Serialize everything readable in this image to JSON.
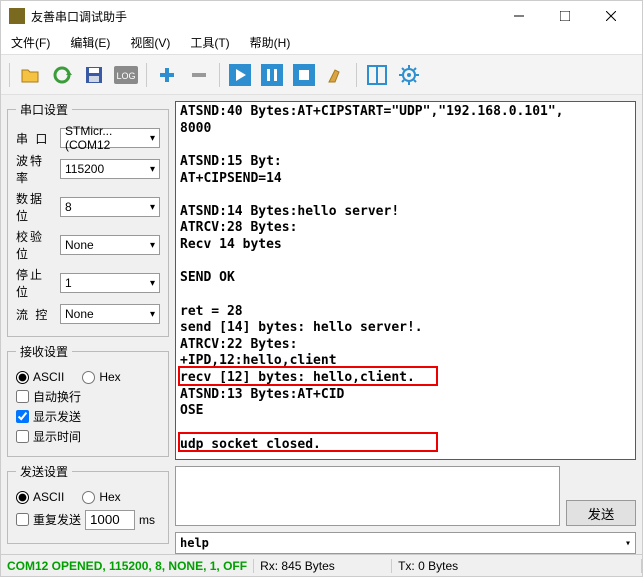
{
  "window": {
    "title": "友善串口调试助手"
  },
  "menu": {
    "file": "文件(F)",
    "edit": "编辑(E)",
    "view": "视图(V)",
    "tools": "工具(T)",
    "help": "帮助(H)"
  },
  "serial": {
    "legend": "串口设置",
    "port_lbl": "串  口",
    "port": "STMicr...(COM12",
    "baud_lbl": "波特率",
    "baud": "115200",
    "databits_lbl": "数据位",
    "databits": "8",
    "parity_lbl": "校验位",
    "parity": "None",
    "stopbits_lbl": "停止位",
    "stopbits": "1",
    "flow_lbl": "流  控",
    "flow": "None"
  },
  "recv": {
    "legend": "接收设置",
    "ascii": "ASCII",
    "hex": "Hex",
    "wrap": "自动换行",
    "show_send": "显示发送",
    "show_time": "显示时间"
  },
  "send": {
    "legend": "发送设置",
    "ascii": "ASCII",
    "hex": "Hex",
    "repeat": "重复发送",
    "interval": "1000",
    "ms": "ms",
    "btn": "发送"
  },
  "rx_lines": [
    "ATSND:40 Bytes:AT+CIPSTART=\"UDP\",\"192.168.0.101\",",
    "8000",
    "",
    "ATSND:15 Byt:",
    "AT+CIPSEND=14",
    "",
    "ATSND:14 Bytes:hello server!",
    "ATRCV:28 Bytes:",
    "Recv 14 bytes",
    "",
    "SEND OK",
    "",
    "ret = 28",
    "send [14] bytes: hello server!.",
    "ATRCV:22 Bytes:",
    "+IPD,12:hello,client",
    "recv [12] bytes: hello,client.",
    "ATSND:13 Bytes:AT+CID",
    "OSE",
    "",
    "udp socket closed.",
    ""
  ],
  "help_text": "help",
  "status": {
    "left": "COM12 OPENED, 115200, 8, NONE, 1, OFF",
    "rx": "Rx: 845 Bytes",
    "tx": "Tx: 0 Bytes"
  }
}
